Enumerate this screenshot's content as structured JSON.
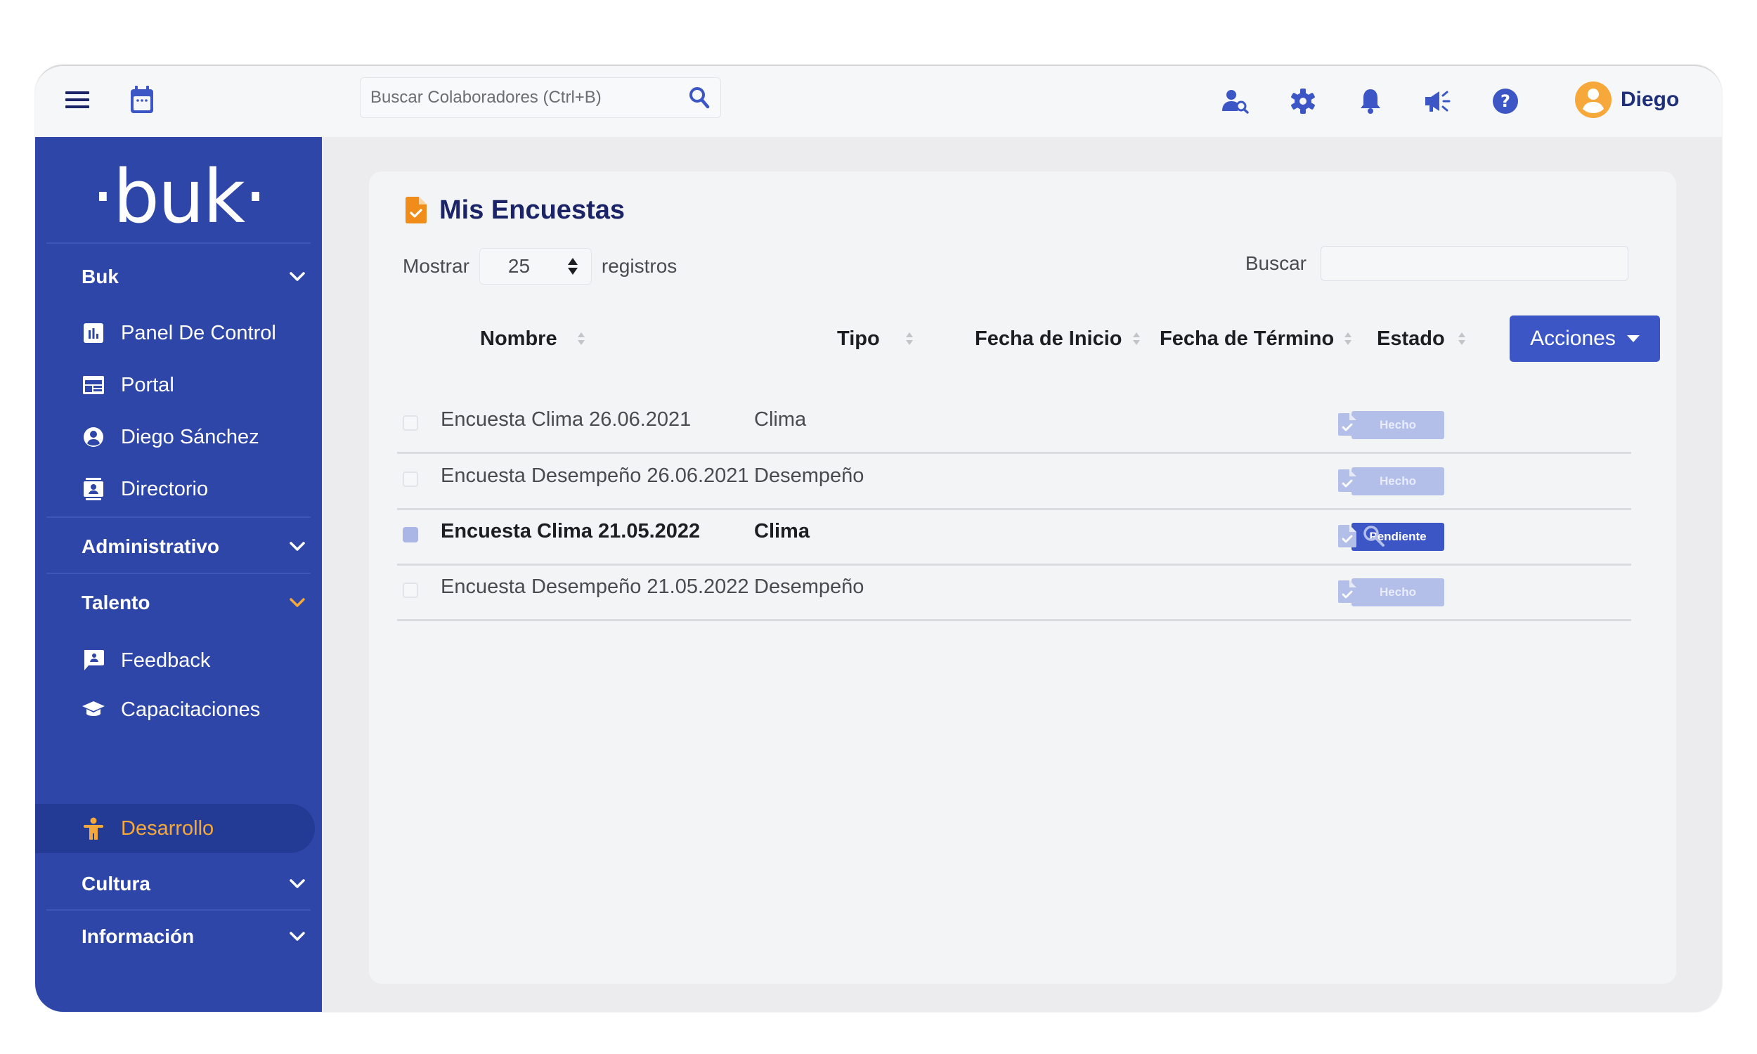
{
  "topbar": {
    "search_placeholder": "Buscar Colaboradores (Ctrl+B)",
    "search_value": "",
    "icons": [
      "menu-icon",
      "calendar-icon",
      "search-icon",
      "user-search-icon",
      "gear-icon",
      "bell-icon",
      "megaphone-icon",
      "help-icon",
      "avatar-icon"
    ],
    "user_name": "Diego"
  },
  "sidebar": {
    "logo": "·buk·",
    "groups": [
      {
        "label": "Buk",
        "expanded": true,
        "items": [
          {
            "label": "Panel De Control",
            "icon": "chart-icon"
          },
          {
            "label": "Portal",
            "icon": "portal-icon"
          },
          {
            "label": "Diego Sánchez",
            "icon": "user-circle-icon"
          },
          {
            "label": "Directorio",
            "icon": "contact-book-icon"
          }
        ]
      },
      {
        "label": "Administrativo",
        "expanded": false,
        "items": []
      },
      {
        "label": "Talento",
        "expanded": true,
        "items": [
          {
            "label": "Feedback",
            "icon": "feedback-icon"
          },
          {
            "label": "Capacitaciones",
            "icon": "graduation-cap-icon"
          },
          {
            "label": "Desarrollo",
            "icon": "person-icon",
            "active": true
          }
        ]
      },
      {
        "label": "Cultura",
        "expanded": false,
        "items": []
      },
      {
        "label": "Información",
        "expanded": false,
        "items": []
      }
    ]
  },
  "colors": {
    "primary": "#2e46a7",
    "accent": "#f6a83a",
    "button": "#3c57c5",
    "badge_done": "#b3bfe8",
    "title": "#1a2466"
  },
  "main": {
    "title": "Mis Encuestas",
    "title_icon": "file-check-icon",
    "length": {
      "prefix": "Mostrar",
      "value": "25",
      "suffix": "registros"
    },
    "filter": {
      "label": "Buscar",
      "value": ""
    },
    "columns": [
      "Nombre",
      "Tipo",
      "Fecha de Inicio",
      "Fecha de Término",
      "Estado"
    ],
    "actions_label": "Acciones",
    "rows": [
      {
        "name": "Encuesta Clima 26.06.2021",
        "tipo": "Clima",
        "fecha_inicio": "",
        "fecha_termino": "",
        "estado": "Hecho",
        "selected": false
      },
      {
        "name": "Encuesta Desempeño 26.06.2021",
        "tipo": "Desempeño",
        "fecha_inicio": "",
        "fecha_termino": "",
        "estado": "Hecho",
        "selected": false
      },
      {
        "name": "Encuesta Clima 21.05.2022",
        "tipo": "Clima",
        "fecha_inicio": "",
        "fecha_termino": "",
        "estado": "Pendiente",
        "selected": true
      },
      {
        "name": "Encuesta Desempeño 21.05.2022",
        "tipo": "Desempeño",
        "fecha_inicio": "",
        "fecha_termino": "",
        "estado": "Hecho",
        "selected": false
      }
    ]
  }
}
